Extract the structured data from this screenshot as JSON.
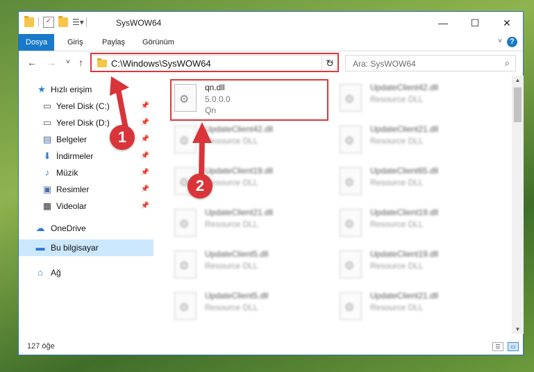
{
  "window": {
    "title": "SysWOW64",
    "minimize": "—",
    "maximize": "☐",
    "close": "✕"
  },
  "ribbon": {
    "tabs": [
      "Dosya",
      "Giriş",
      "Paylaş",
      "Görünüm"
    ],
    "help": "?"
  },
  "nav": {
    "back": "←",
    "forward": "→",
    "recent": "˅",
    "up": "↑",
    "address_path": "C:\\Windows\\SysWOW64",
    "search_placeholder": "Ara: SysWOW64"
  },
  "sidebar": {
    "items": [
      {
        "label": "Hızlı erişim",
        "icon": "star-icon"
      },
      {
        "label": "Yerel Disk (C:)",
        "icon": "drive-icon",
        "pinned": true
      },
      {
        "label": "Yerel Disk (D:)",
        "icon": "drive-icon",
        "pinned": true
      },
      {
        "label": "Belgeler",
        "icon": "document-icon",
        "pinned": true
      },
      {
        "label": "İndirmeler",
        "icon": "download-icon",
        "pinned": true
      },
      {
        "label": "Müzik",
        "icon": "music-icon",
        "pinned": true
      },
      {
        "label": "Resimler",
        "icon": "pictures-icon",
        "pinned": true
      },
      {
        "label": "Videolar",
        "icon": "videos-icon",
        "pinned": true
      },
      {
        "label": "OneDrive",
        "icon": "cloud-icon"
      },
      {
        "label": "Bu bilgisayar",
        "icon": "computer-icon",
        "selected": true
      },
      {
        "label": "Ağ",
        "icon": "network-icon"
      }
    ]
  },
  "files": {
    "highlighted": {
      "name": "qn.dll",
      "version": "5.0.0.0",
      "company": "Qn"
    },
    "col1": [
      {
        "name": "UpdateClient42.dll",
        "desc": "Resource DLL"
      },
      {
        "name": "UpdateClient19.dll",
        "desc": "Resource DLL"
      },
      {
        "name": "UpdateClient21.dll",
        "desc": "Resource DLL"
      },
      {
        "name": "UpdateClient5.dll",
        "desc": "Resource DLL"
      },
      {
        "name": "UpdateClient5.dll",
        "desc": "Resource DLL"
      }
    ],
    "col2": [
      {
        "name": "UpdateClient42.dll",
        "desc": "Resource DLL"
      },
      {
        "name": "UpdateClient21.dll",
        "desc": "Resource DLL"
      },
      {
        "name": "UpdateClient65.dll",
        "desc": "Resource DLL"
      },
      {
        "name": "UpdateClient19.dll",
        "desc": "Resource DLL"
      },
      {
        "name": "UpdateClient19.dll",
        "desc": "Resource DLL"
      },
      {
        "name": "UpdateClient21.dll",
        "desc": "Resource DLL"
      }
    ]
  },
  "status": {
    "item_count": "127 öğe"
  },
  "annotations": {
    "step1": "1",
    "step2": "2",
    "color": "#e0353a"
  }
}
